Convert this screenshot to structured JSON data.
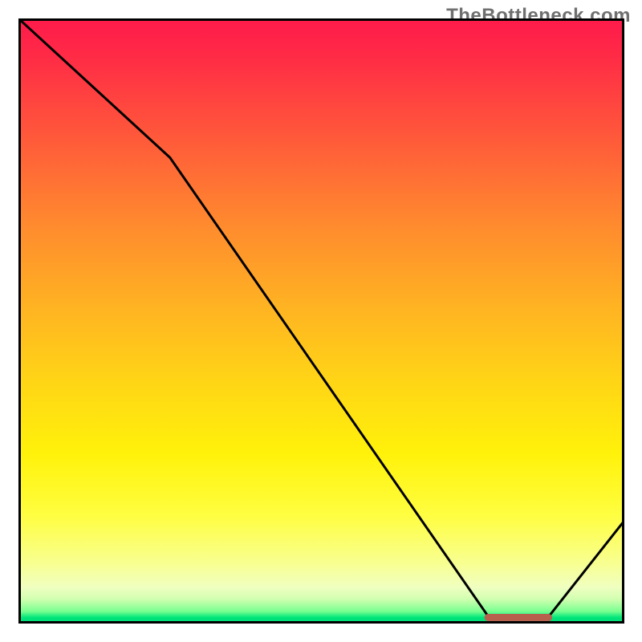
{
  "attribution": "TheBottleneck.com",
  "chart_data": {
    "type": "line",
    "title": "",
    "xlabel": "",
    "ylabel": "",
    "xlim": [
      0,
      100
    ],
    "ylim": [
      0,
      100
    ],
    "series": [
      {
        "name": "bottleneck-curve",
        "x": [
          0,
          25,
          78,
          87,
          100
        ],
        "y": [
          100,
          77,
          0.5,
          0.5,
          17
        ]
      }
    ],
    "marker": {
      "name": "optimal-range",
      "x_start": 77.5,
      "x_end": 87.5,
      "y": 1
    },
    "gradient_stops": [
      {
        "pos": 0,
        "color": "#ff1a4b"
      },
      {
        "pos": 50,
        "color": "#ffc81e"
      },
      {
        "pos": 85,
        "color": "#fffe60"
      },
      {
        "pos": 100,
        "color": "#00d876"
      }
    ]
  }
}
